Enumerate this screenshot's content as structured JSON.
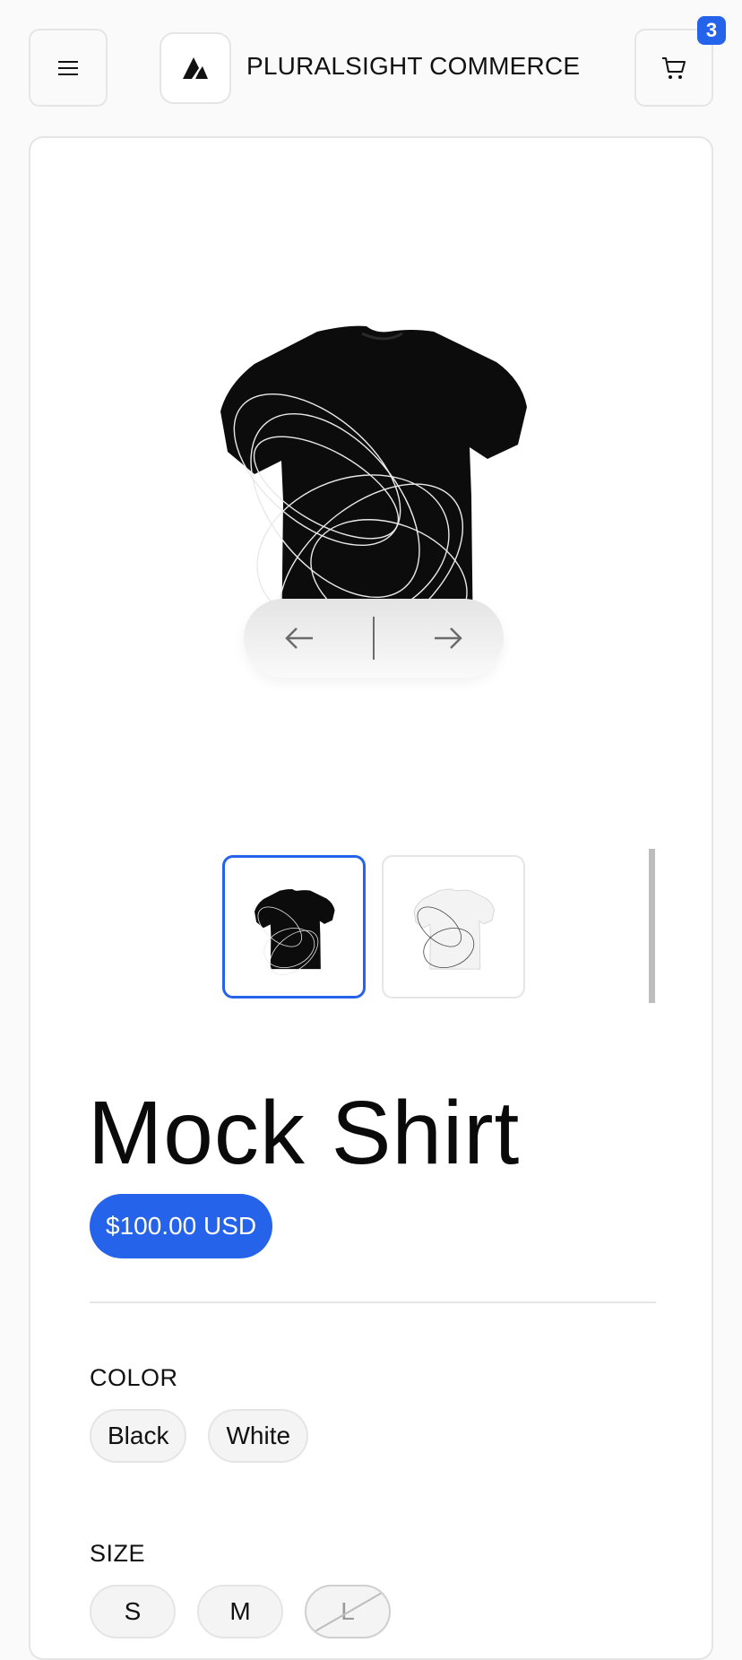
{
  "header": {
    "store_name": "PLURALSIGHT COMMERCE",
    "cart_count": "3",
    "menu_icon": "hamburger-icon",
    "cart_icon": "shopping-cart-icon",
    "logo_icon": "pluralsight-logo"
  },
  "product": {
    "title": "Mock Shirt",
    "price": "$100.00 USD",
    "options": {
      "color_label": "COLOR",
      "colors": [
        "Black",
        "White"
      ],
      "size_label": "SIZE",
      "sizes": [
        "S",
        "M",
        "L"
      ]
    }
  },
  "colors": {
    "accent": "#2563eb",
    "border": "#e5e5e5"
  }
}
